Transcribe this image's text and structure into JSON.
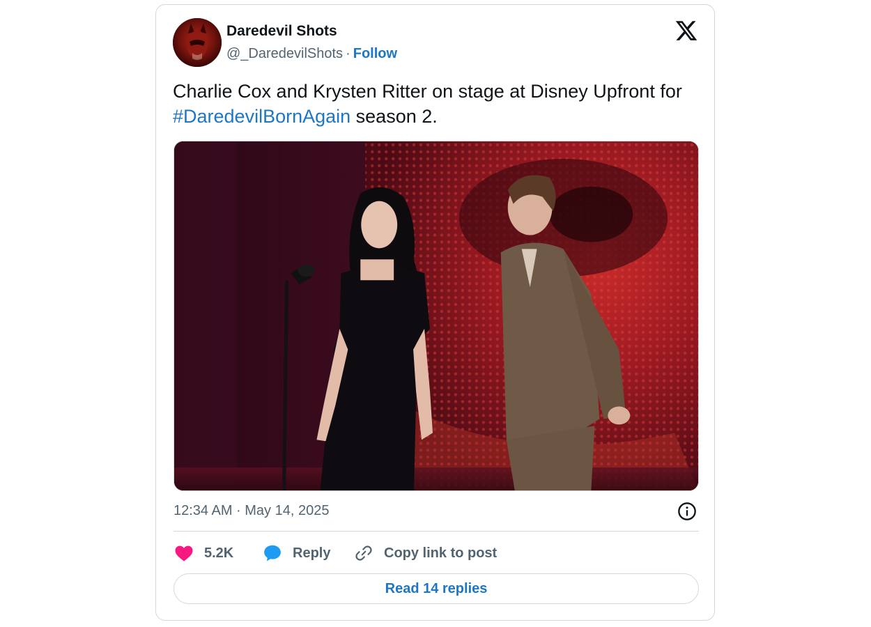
{
  "author": {
    "name": "Daredevil Shots",
    "handle": "@_DaredevilShots",
    "separator": "·",
    "follow_label": "Follow"
  },
  "tweet": {
    "text_before": "Charlie Cox and Krysten Ritter on stage at Disney Upfront for ",
    "hashtag": "#DaredevilBornAgain",
    "text_after": " season 2.",
    "timestamp": "12:34 AM · May 14, 2025"
  },
  "photo": {
    "subject": "Two people standing on a stage in front of a large red screen, one at a microphone"
  },
  "actions": {
    "like_count": "5.2K",
    "reply_label": "Reply",
    "copy_link_label": "Copy link to post"
  },
  "read_replies_label": "Read 14 replies",
  "icons": {
    "platform": "x-logo-icon",
    "info": "info-icon",
    "like": "heart-icon",
    "reply": "speech-bubble-icon",
    "copy": "link-icon"
  },
  "colors": {
    "link": "#1d76c6",
    "like": "#f91880",
    "reply": "#1d9bf0",
    "secondary_text": "#536471",
    "border": "#cfd9de"
  }
}
